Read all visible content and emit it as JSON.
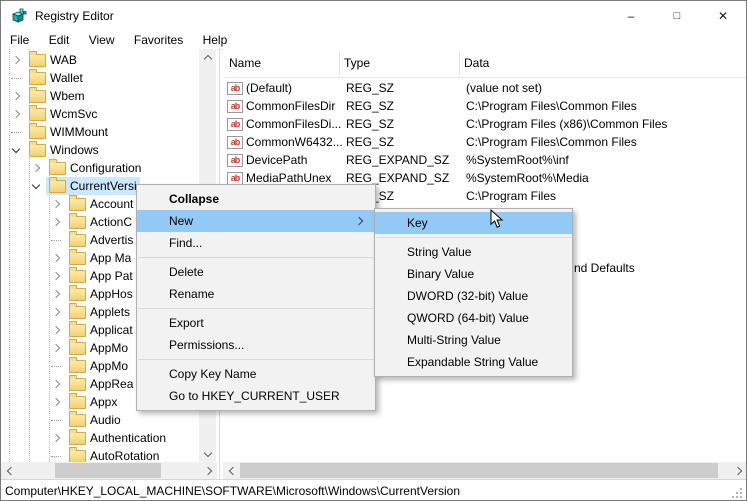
{
  "window": {
    "title": "Registry Editor",
    "controls": {
      "minimize": "–",
      "maximize": "□",
      "close": "✕"
    }
  },
  "menu_bar": {
    "items": [
      "File",
      "Edit",
      "View",
      "Favorites",
      "Help"
    ]
  },
  "tree": {
    "items": [
      {
        "label": "WAB",
        "state": "collapsed"
      },
      {
        "label": "Wallet",
        "state": "leaf"
      },
      {
        "label": "Wbem",
        "state": "collapsed"
      },
      {
        "label": "WcmSvc",
        "state": "collapsed"
      },
      {
        "label": "WIMMount",
        "state": "leaf"
      },
      {
        "label": "Windows",
        "state": "expanded"
      },
      {
        "label": "Configuration",
        "state": "collapsed"
      },
      {
        "label": "CurrentVersi",
        "state": "expanded",
        "selected": true
      },
      {
        "label": "Account",
        "state": "collapsed"
      },
      {
        "label": "ActionC",
        "state": "collapsed"
      },
      {
        "label": "Advertis",
        "state": "leaf"
      },
      {
        "label": "App Ma",
        "state": "collapsed"
      },
      {
        "label": "App Pat",
        "state": "collapsed"
      },
      {
        "label": "AppHos",
        "state": "collapsed"
      },
      {
        "label": "Applets",
        "state": "collapsed"
      },
      {
        "label": "Applicat",
        "state": "collapsed"
      },
      {
        "label": "AppMo",
        "state": "collapsed"
      },
      {
        "label": "AppMo",
        "state": "leaf"
      },
      {
        "label": "AppRea",
        "state": "collapsed"
      },
      {
        "label": "Appx",
        "state": "collapsed"
      },
      {
        "label": "Audio",
        "state": "leaf"
      },
      {
        "label": "Authentication",
        "state": "collapsed"
      },
      {
        "label": "AutoRotation",
        "state": "leaf"
      }
    ]
  },
  "list": {
    "columns": [
      "Name",
      "Type",
      "Data"
    ],
    "rows": [
      {
        "name": "(Default)",
        "type": "REG_SZ",
        "data": "(value not set)"
      },
      {
        "name": "CommonFilesDir",
        "type": "REG_SZ",
        "data": "C:\\Program Files\\Common Files"
      },
      {
        "name": "CommonFilesDi...",
        "type": "REG_SZ",
        "data": "C:\\Program Files (x86)\\Common Files"
      },
      {
        "name": "CommonW6432...",
        "type": "REG_SZ",
        "data": "C:\\Program Files\\Common Files"
      },
      {
        "name": "DevicePath",
        "type": "REG_EXPAND_SZ",
        "data": "%SystemRoot%\\inf"
      },
      {
        "name": "MediaPathUnex",
        "type": "REG_EXPAND_SZ",
        "data": "%SystemRoot%\\Media"
      },
      {
        "name": "",
        "type": "REG_SZ",
        "data": "C:\\Program Files"
      }
    ],
    "partially_hidden_row": {
      "data_fragment": "nd Defaults"
    }
  },
  "context_menu": {
    "items": [
      "Collapse",
      "New",
      "Find...",
      "Delete",
      "Rename",
      "Export",
      "Permissions...",
      "Copy Key Name",
      "Go to HKEY_CURRENT_USER"
    ],
    "highlighted": "New"
  },
  "submenu": {
    "items": [
      "Key",
      "String Value",
      "Binary Value",
      "DWORD (32-bit) Value",
      "QWORD (64-bit) Value",
      "Multi-String Value",
      "Expandable String Value"
    ],
    "highlighted": "Key"
  },
  "status_bar": {
    "path": "Computer\\HKEY_LOCAL_MACHINE\\SOFTWARE\\Microsoft\\Windows\\CurrentVersion"
  },
  "colors": {
    "menu_highlight": "#91c9f7",
    "tree_selection": "#cce8ff",
    "folder_icon": "#f4d172",
    "value_icon_text": "#cf3b28",
    "scrollbar_track": "#f0f0f0",
    "scrollbar_thumb": "#cdcdcd"
  }
}
